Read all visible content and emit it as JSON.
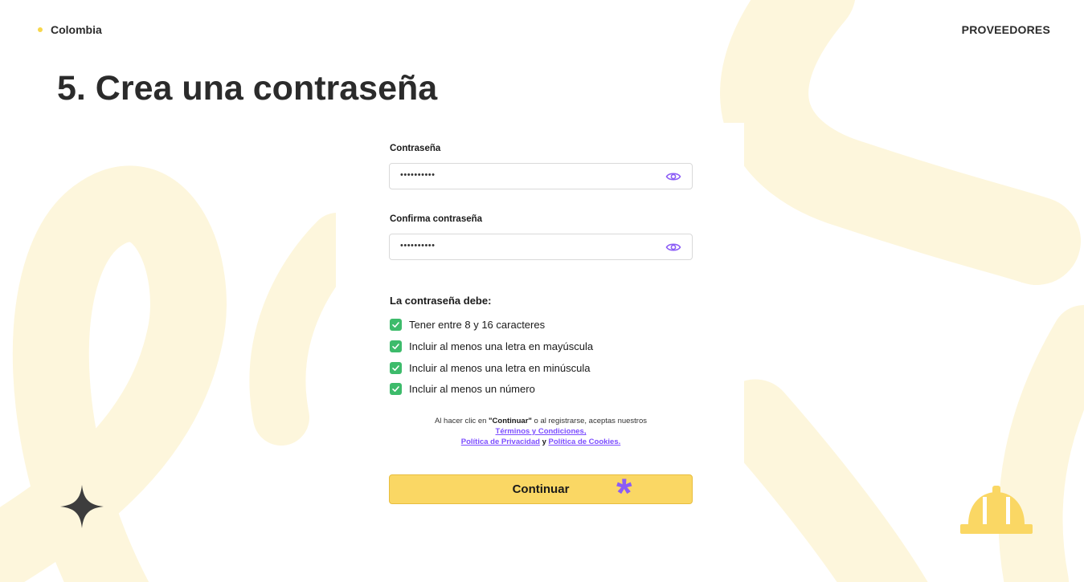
{
  "header": {
    "country": "Colombia",
    "section": "PROVEEDORES"
  },
  "slide": {
    "title": "5. Crea una contraseña"
  },
  "form": {
    "password": {
      "label": "Contraseña",
      "value": "••••••••••"
    },
    "confirm_password": {
      "label": "Confirma contraseña",
      "value": "••••••••••"
    },
    "requirements_title": "La contraseña debe:",
    "requirements": [
      "Tener entre 8 y 16 caracteres",
      "Incluir al menos una letra en mayúscula",
      "Incluir al menos una letra en minúscula",
      "Incluir al menos un número"
    ],
    "legal": {
      "prefix": "Al hacer clic en ",
      "continue_word": "\"Continuar\"",
      "middle": " o al registrarse, aceptas nuestros",
      "terms_link": "Términos y Condiciones,",
      "privacy_link": "Política de Privacidad",
      "and": " y ",
      "cookies_link": "Política de Cookies."
    },
    "submit_label": "Continuar"
  },
  "colors": {
    "brand_yellow": "#fad764",
    "accent_purple": "#8b5cf6",
    "check_green": "#3dbb6b",
    "background_shape": "#fdf6dc"
  },
  "icons": {
    "password_toggle": "eye-icon",
    "check": "checkbox-checked-icon",
    "decor_left": "sparkle-icon",
    "decor_right": "hard-hat-icon",
    "highlight": "asterisk-icon"
  }
}
